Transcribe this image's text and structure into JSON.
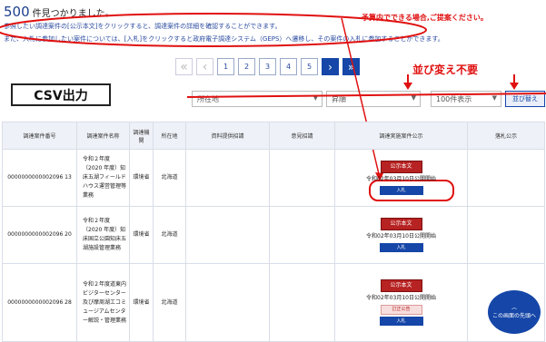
{
  "result": {
    "count": "500",
    "suffix": "件見つかりました。"
  },
  "info": {
    "line1": "参照したい調達案件の[公示本文]をクリックすると、調達案件の詳細を確認することができます。",
    "line2": "また、入札に参加したい案件については、[入札]をクリックすると政府電子調達システム（GEPS）へ遷移し、その案件の入札に参加することができます。"
  },
  "pagination": {
    "pages": [
      "1",
      "2",
      "3",
      "4",
      "5"
    ],
    "current": "1"
  },
  "annotations": {
    "csv": "CSV出力",
    "no_sort": "並び変え不要",
    "budget_note": "予算内でできる場合,ご提案ください。"
  },
  "filters": {
    "sort_field": "所在地",
    "order": "昇順",
    "per_page": "100件表示",
    "sort_button": "並び替え"
  },
  "table": {
    "headers": [
      "調達案件番号",
      "調達案件名称",
      "調達機関",
      "所在地",
      "資料提供招請",
      "意見招請",
      "調達実施案件公示",
      "落札公示"
    ],
    "rows": [
      {
        "id": "0000000000002096 13",
        "name": "令和２年度（2020 年度）知床五湖フィールドハウス運営管理等業務",
        "org": "環境省",
        "loc": "北海道",
        "notice": "公示本文",
        "release": "令和02年03月10日公開開始",
        "bid": "入札",
        "corr": ""
      },
      {
        "id": "0000000000002096 20",
        "name": "令和２年度（2020 年度）知床国立公園知床五湖施設管理業務",
        "org": "環境省",
        "loc": "北海道",
        "notice": "公示本文",
        "release": "令和02年03月10日公開開始",
        "bid": "入札",
        "corr": ""
      },
      {
        "id": "0000000000002096 28",
        "name": "令和２年度道東内ビジターセンター及び摩周湖エコミュージアムセンター解説・管理業務",
        "org": "環境省",
        "loc": "北海道",
        "notice": "公示本文",
        "release": "令和02年03月10日公開開始",
        "bid": "入札",
        "corr": "訂正公告"
      }
    ]
  },
  "back_to_top": "この画面の先頭へ",
  "colors": {
    "primary": "#1546a8",
    "annotation": "#e01010",
    "notice": "#b72222"
  }
}
